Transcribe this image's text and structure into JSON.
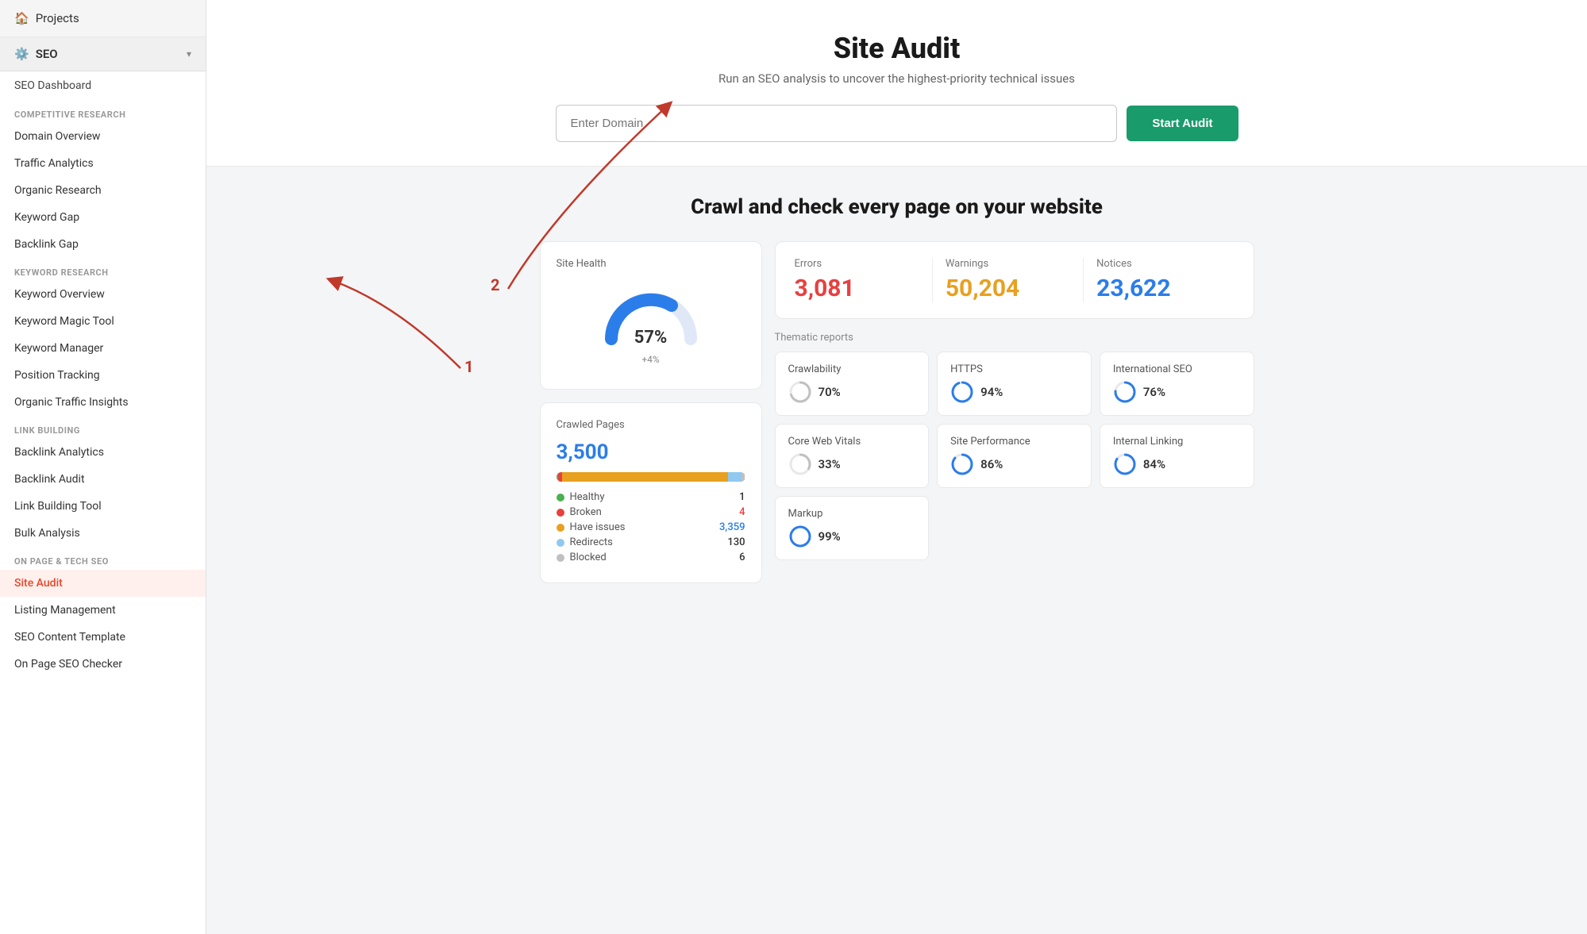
{
  "sidebar": {
    "projects_label": "Projects",
    "seo_label": "SEO",
    "seo_dashboard": "SEO Dashboard",
    "sections": [
      {
        "id": "competitive",
        "label": "COMPETITIVE RESEARCH",
        "items": [
          {
            "id": "domain-overview",
            "label": "Domain Overview"
          },
          {
            "id": "traffic-analytics",
            "label": "Traffic Analytics"
          },
          {
            "id": "organic-research",
            "label": "Organic Research"
          },
          {
            "id": "keyword-gap",
            "label": "Keyword Gap"
          },
          {
            "id": "backlink-gap",
            "label": "Backlink Gap"
          }
        ]
      },
      {
        "id": "keyword-research",
        "label": "KEYWORD RESEARCH",
        "items": [
          {
            "id": "keyword-overview",
            "label": "Keyword Overview"
          },
          {
            "id": "keyword-magic-tool",
            "label": "Keyword Magic Tool"
          },
          {
            "id": "keyword-manager",
            "label": "Keyword Manager"
          },
          {
            "id": "position-tracking",
            "label": "Position Tracking"
          },
          {
            "id": "organic-traffic-insights",
            "label": "Organic Traffic Insights"
          }
        ]
      },
      {
        "id": "link-building",
        "label": "LINK BUILDING",
        "items": [
          {
            "id": "backlink-analytics",
            "label": "Backlink Analytics"
          },
          {
            "id": "backlink-audit",
            "label": "Backlink Audit"
          },
          {
            "id": "link-building-tool",
            "label": "Link Building Tool"
          },
          {
            "id": "bulk-analysis",
            "label": "Bulk Analysis"
          }
        ]
      },
      {
        "id": "on-page-tech-seo",
        "label": "ON PAGE & TECH SEO",
        "items": [
          {
            "id": "site-audit",
            "label": "Site Audit",
            "active": true
          },
          {
            "id": "listing-management",
            "label": "Listing Management"
          },
          {
            "id": "seo-content-template",
            "label": "SEO Content Template"
          },
          {
            "id": "on-page-seo-checker",
            "label": "On Page SEO Checker"
          }
        ]
      }
    ]
  },
  "main": {
    "page_title": "Site Audit",
    "page_subtitle": "Run an SEO analysis to uncover the highest-priority technical issues",
    "domain_placeholder": "Enter Domain",
    "start_audit_label": "Start Audit",
    "crawl_heading": "Crawl and check every page on your website",
    "annotation_1": "1",
    "annotation_2": "2"
  },
  "dashboard": {
    "site_health": {
      "title": "Site Health",
      "percentage": "57%",
      "change": "+4%"
    },
    "crawled_pages": {
      "title": "Crawled Pages",
      "number": "3,500",
      "legend": [
        {
          "id": "healthy",
          "label": "Healthy",
          "value": "1",
          "color": "#4caf50",
          "pct": 0.01
        },
        {
          "id": "broken",
          "label": "Broken",
          "value": "4",
          "color": "#e84040",
          "pct": 0.02
        },
        {
          "id": "have-issues",
          "label": "Have issues",
          "value": "3,359",
          "color": "#e8a020",
          "pct": 0.88
        },
        {
          "id": "redirects",
          "label": "Redirects",
          "value": "130",
          "color": "#90c8f0",
          "pct": 0.07
        },
        {
          "id": "blocked",
          "label": "Blocked",
          "value": "6",
          "color": "#c0c0c0",
          "pct": 0.02
        }
      ]
    },
    "errors": {
      "errors_label": "Errors",
      "errors_value": "3,081",
      "warnings_label": "Warnings",
      "warnings_value": "50,204",
      "notices_label": "Notices",
      "notices_value": "23,622"
    },
    "thematic": {
      "title": "Thematic reports",
      "reports": [
        {
          "id": "crawlability",
          "name": "Crawlability",
          "pct": 70,
          "color": "#c0c0c0",
          "track": "#e8e8e8"
        },
        {
          "id": "https",
          "name": "HTTPS",
          "pct": 94,
          "color": "#2b7de9",
          "track": "#e8e8e8"
        },
        {
          "id": "international-seo",
          "name": "International SEO",
          "pct": 76,
          "color": "#2b7de9",
          "track": "#e8e8e8"
        },
        {
          "id": "core-web-vitals",
          "name": "Core Web Vitals",
          "pct": 33,
          "color": "#c0c0c0",
          "track": "#e8e8e8"
        },
        {
          "id": "site-performance",
          "name": "Site Performance",
          "pct": 86,
          "color": "#2b7de9",
          "track": "#e8e8e8"
        },
        {
          "id": "internal-linking",
          "name": "Internal Linking",
          "pct": 84,
          "color": "#2b7de9",
          "track": "#e8e8e8"
        },
        {
          "id": "markup",
          "name": "Markup",
          "pct": 99,
          "color": "#2b7de9",
          "track": "#e8e8e8"
        }
      ]
    }
  }
}
